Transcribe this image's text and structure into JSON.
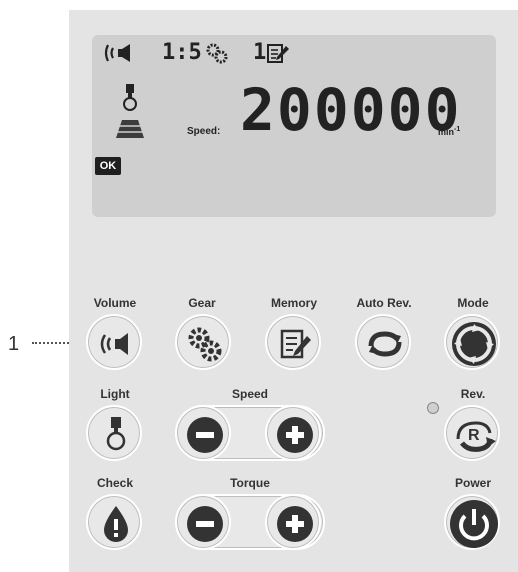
{
  "callout": {
    "number": "1"
  },
  "display": {
    "ratio": "1:5",
    "memory_num": "1",
    "speed_label": "Speed:",
    "speed_value": "200000",
    "unit": "min",
    "unit_exp": "-1",
    "ok": "OK",
    "icons": [
      "volume-icon",
      "gear-icon",
      "memory-icon",
      "light-icon"
    ]
  },
  "buttons": {
    "volume": "Volume",
    "gear": "Gear",
    "memory": "Memory",
    "auto_rev": "Auto Rev.",
    "mode": "Mode",
    "light": "Light",
    "speed": "Speed",
    "rev": "Rev.",
    "check": "Check",
    "torque": "Torque",
    "power": "Power"
  },
  "colors": {
    "panel": "#e4e4e4",
    "lcd": "#cfcfcf",
    "dark": "#333333"
  }
}
